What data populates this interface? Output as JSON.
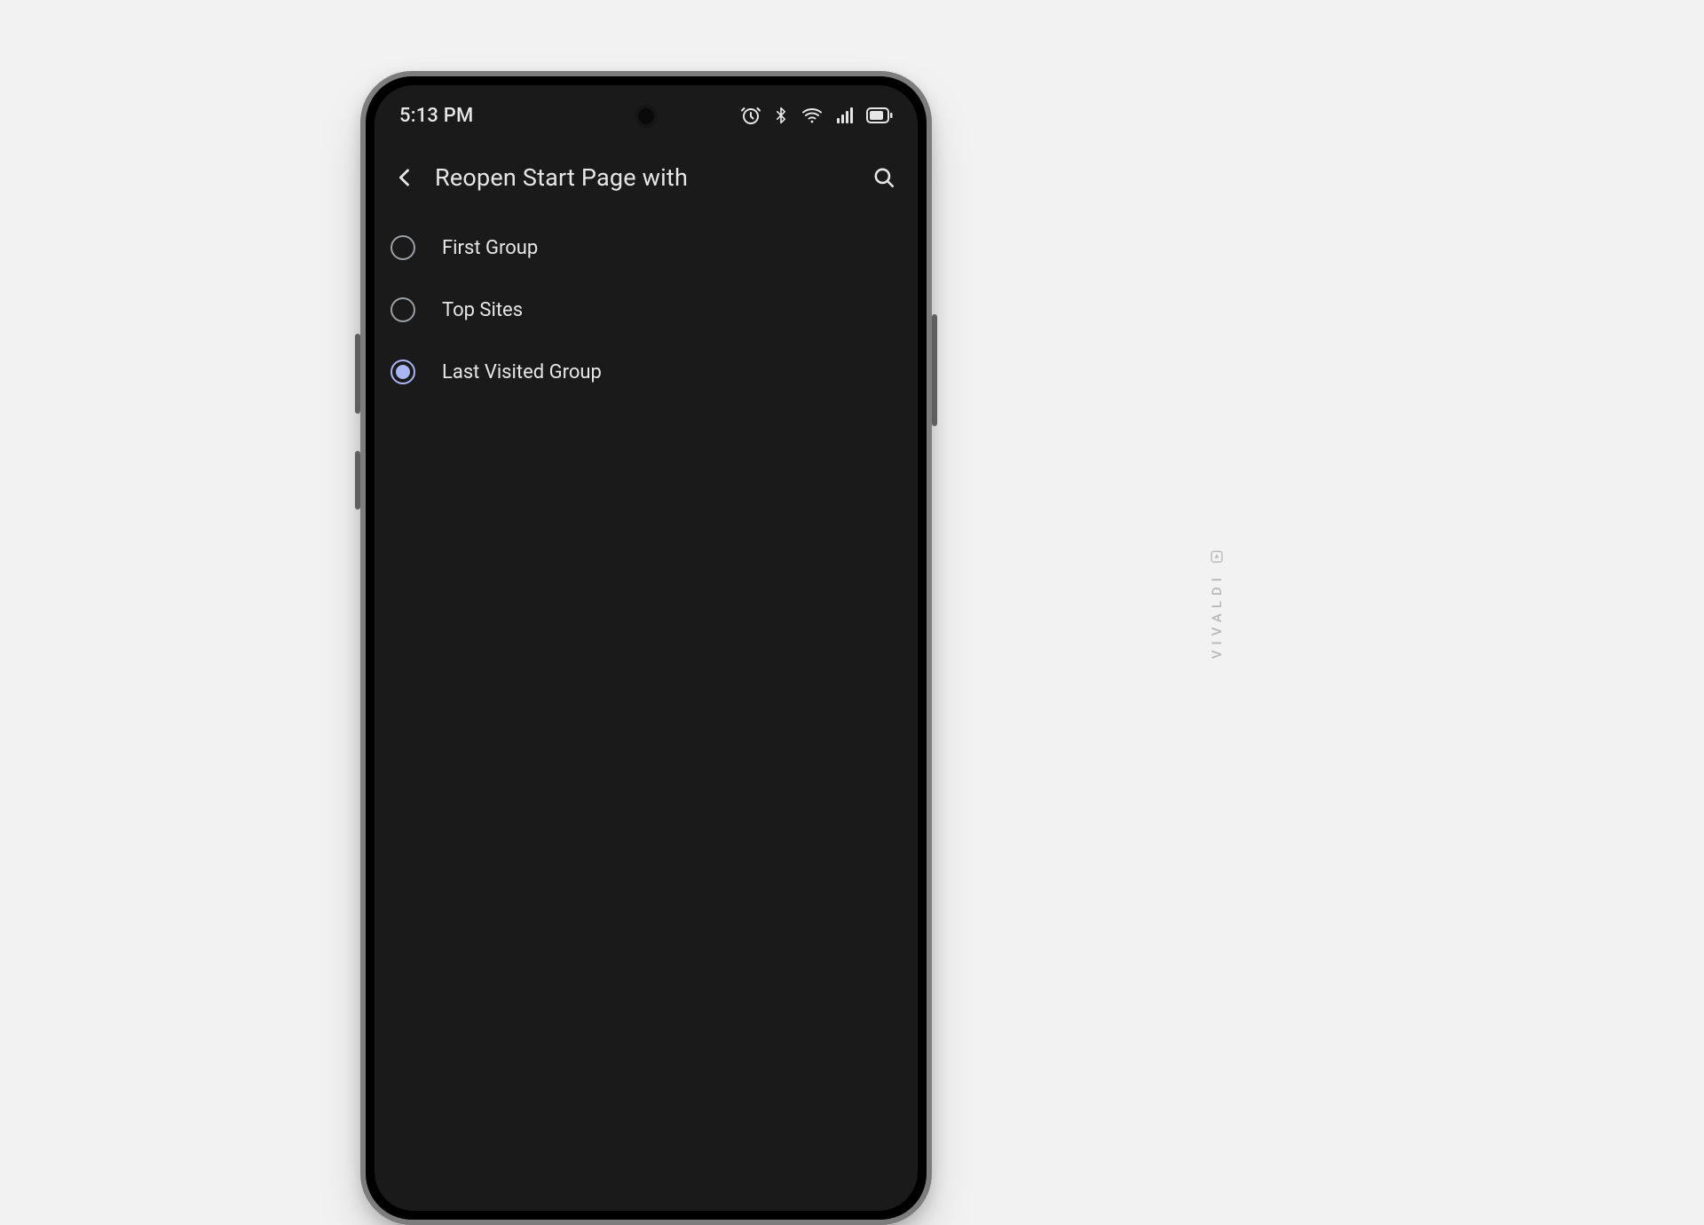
{
  "statusbar": {
    "time": "5:13 PM"
  },
  "appbar": {
    "title": "Reopen Start Page with"
  },
  "options": [
    {
      "label": "First Group",
      "selected": false
    },
    {
      "label": "Top Sites",
      "selected": false
    },
    {
      "label": "Last Visited Group",
      "selected": true
    }
  ],
  "brand": "VIVALDI"
}
